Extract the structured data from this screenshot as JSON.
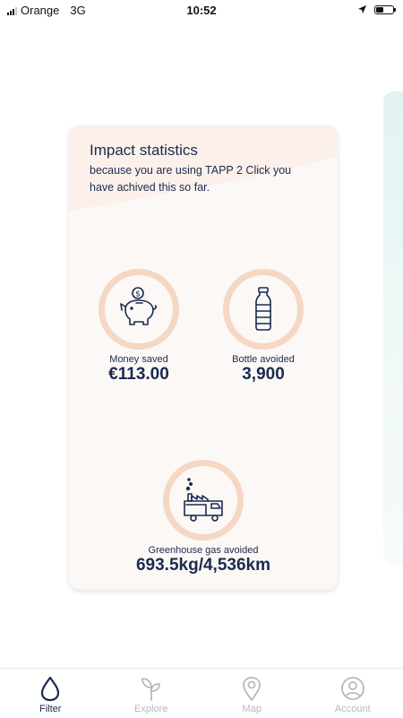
{
  "status_bar": {
    "carrier": "Orange",
    "network": "3G",
    "time": "10:52"
  },
  "card": {
    "title": "Impact statistics",
    "subtitle": "because you are using TAPP 2 Click you have achived this so far.",
    "stats": [
      {
        "label": "Money saved",
        "value": "€113.00",
        "icon": "piggy-bank-icon"
      },
      {
        "label": "Bottle avoided",
        "value": "3,900",
        "icon": "bottle-icon"
      },
      {
        "label": "Greenhouse gas avoided",
        "value": "693.5kg/4,536km",
        "icon": "truck-factory-icon"
      }
    ]
  },
  "tabs": [
    {
      "label": "Filter",
      "icon": "drop-icon",
      "active": true
    },
    {
      "label": "Explore",
      "icon": "sprout-icon",
      "active": false
    },
    {
      "label": "Map",
      "icon": "map-pin-icon",
      "active": false
    },
    {
      "label": "Account",
      "icon": "user-circle-icon",
      "active": false
    }
  ],
  "colors": {
    "navy": "#1b2a4e",
    "ring": "#f5d7c3",
    "card_bg": "#fbf8f6",
    "inactive_tab": "#b4b8bf",
    "peek_card": "#e3f3f2"
  }
}
